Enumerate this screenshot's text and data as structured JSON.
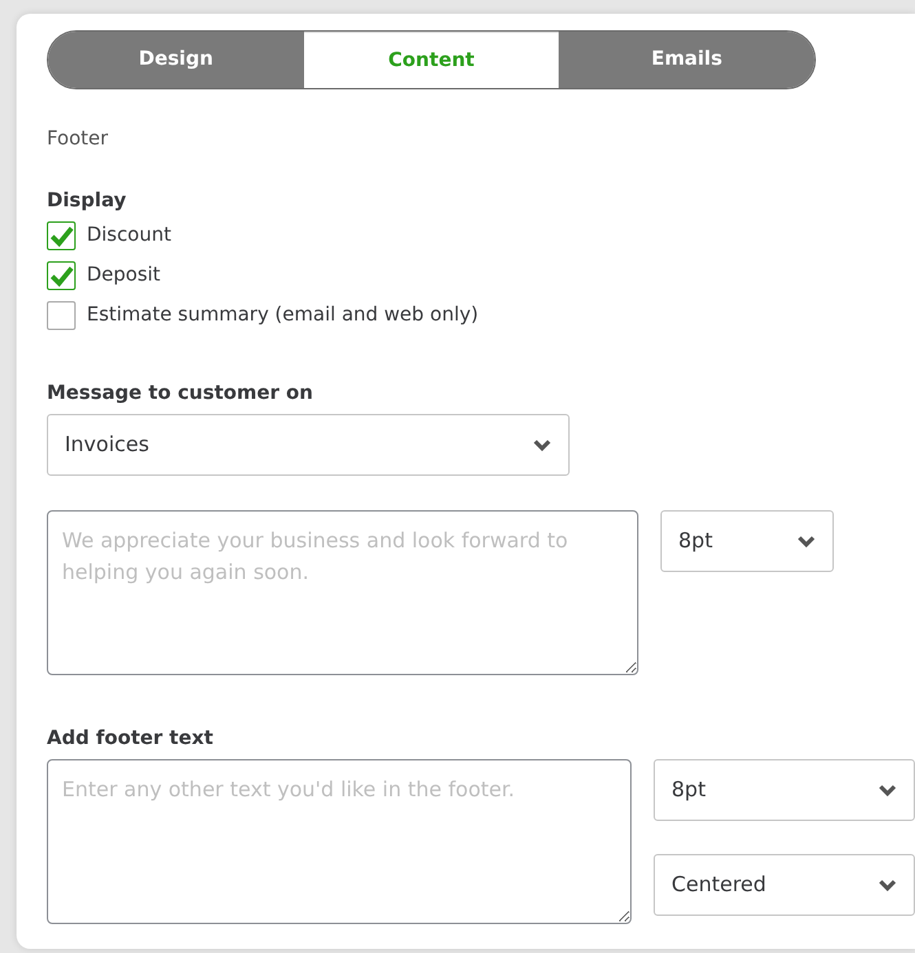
{
  "tabs": [
    {
      "label": "Design",
      "selected": false
    },
    {
      "label": "Content",
      "selected": true
    },
    {
      "label": "Emails",
      "selected": false
    }
  ],
  "section_title": "Footer",
  "display": {
    "label": "Display",
    "options": [
      {
        "label": "Discount",
        "checked": true
      },
      {
        "label": "Deposit",
        "checked": true
      },
      {
        "label": "Estimate summary (email and web only)",
        "checked": false
      }
    ]
  },
  "message": {
    "label": "Message to customer on",
    "select": "Invoices",
    "textarea": {
      "placeholder": "We appreciate your business and look forward to helping you again soon."
    },
    "font_size": "8pt"
  },
  "footer_text": {
    "label": "Add footer text",
    "textarea": {
      "placeholder": "Enter any other text you'd like in the footer."
    },
    "font_size": "8pt",
    "alignment": "Centered"
  }
}
